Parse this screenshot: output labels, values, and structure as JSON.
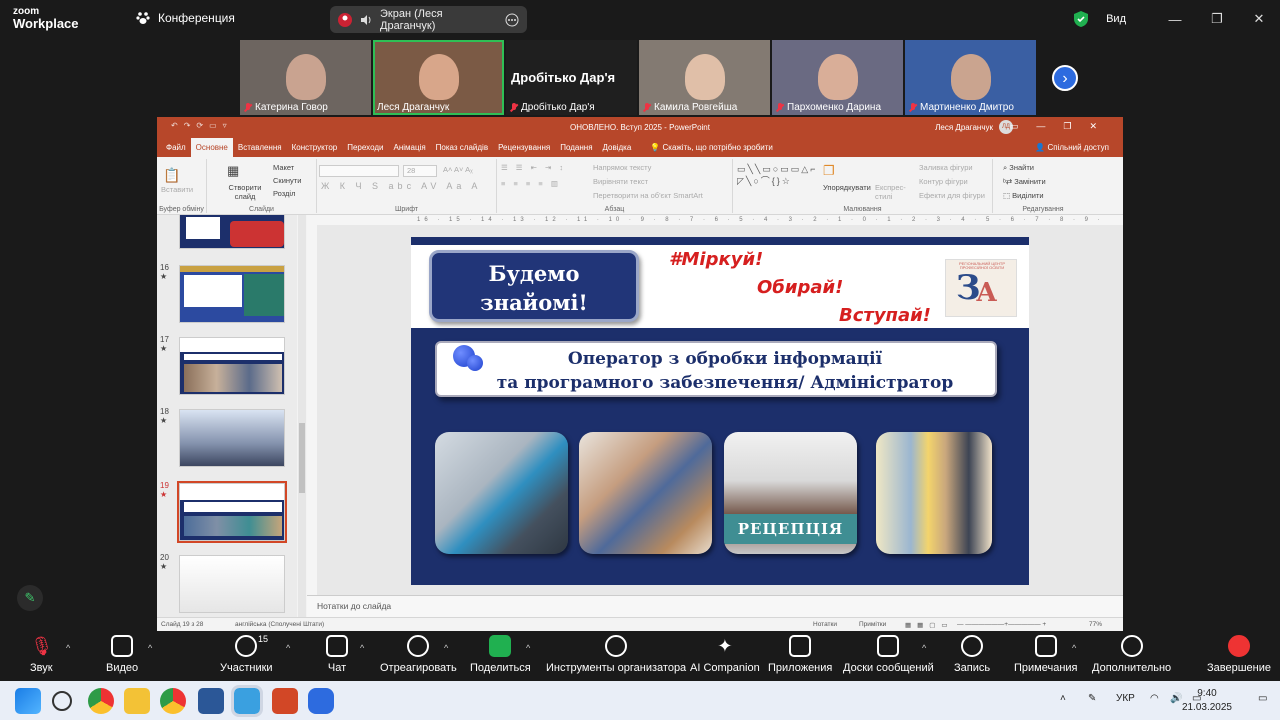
{
  "zoom": {
    "logo_line1": "zoom",
    "logo_line2": "Workplace",
    "conference_label": "Конференция",
    "share_label": "Экран (Леся Драганчук)",
    "view_label": "Вид",
    "more": "···"
  },
  "participants": [
    {
      "name": "Катерина Говор",
      "active": false
    },
    {
      "name": "Леся Драганчук",
      "active": true
    },
    {
      "name": "Дробітько Дар'я",
      "big_label": "Дробітько Дар'я",
      "active": false
    },
    {
      "name": "Камила Ровгейша",
      "active": false
    },
    {
      "name": "Пархоменко Дарина",
      "active": false
    },
    {
      "name": "Мартиненко Дмитро",
      "active": false
    }
  ],
  "ppt": {
    "title": "ОНОВЛЕНО. Вступ 2025  -  PowerPoint",
    "user": "Леся Драганчук",
    "avatar": "ЛД",
    "tabs": [
      "Файл",
      "Основне",
      "Вставлення",
      "Конструктор",
      "Переходи",
      "Анімація",
      "Показ слайдів",
      "Рецензування",
      "Подання",
      "Довідка"
    ],
    "tell_me": "Скажіть, що потрібно зробити",
    "share_access": "Спільний доступ",
    "ribbon": {
      "paste": "Вставити",
      "create_slide": "Створити слайд",
      "layout": "Макет",
      "reset": "Скинути",
      "section": "Розділ",
      "font_size": "28",
      "text_direction": "Напрямок тексту",
      "align_text": "Вирівняти текст",
      "smartart": "Перетворити на об'єкт SmartArt",
      "arrange": "Упорядкувати",
      "express_styles": "Експрес-стилі",
      "fill": "Заливка фігури",
      "outline": "Контур фігури",
      "effects": "Ефекти для фігури",
      "find": "Знайти",
      "replace": "Замінити",
      "select": "Виділити",
      "group_clipboard": "Буфер обміну",
      "group_slides": "Слайди",
      "group_font": "Шрифт",
      "group_paragraph": "Абзац",
      "group_drawing": "Малювання",
      "group_editing": "Редагування"
    },
    "ruler": "16 · 15 · 14 · 13 · 12 · 11 · 10 · 9 · 8 · 7 · 6 · 5 · 4 · 3 · 2 · 1 · 0 · 1 · 2 · 3 · 4 · 5 · 6 · 7 · 8 · 9 · 10 · 11 · 12 · 13 · 14 · 15 · 16",
    "thumb_numbers": [
      "16",
      "17",
      "18",
      "19",
      "20"
    ],
    "notes_placeholder": "Нотатки до слайда",
    "status": {
      "slide": "Слайд 19 з 28",
      "lang": "англійська (Сполучені Штати)",
      "notes": "Нотатки",
      "comments": "Примітки",
      "zoom": "77%"
    }
  },
  "slide": {
    "hello": "Будемо знайомі!",
    "tag1": "#Міркуй!",
    "tag2": "Обирай!",
    "tag3": "Вступай!",
    "logo_caption": "РЕГІОНАЛЬНИЙ ЦЕНТР ПРОФЕСІЙНОЇ ОСВІТИ",
    "logo_letter1": "З",
    "logo_letter2": "А",
    "banner_line1": "Оператор з обробки інформації",
    "banner_line2": "та програмного забезпечення/ Адміністратор",
    "reception": "РЕЦЕПЦІЯ"
  },
  "toolbar": {
    "audio": "Звук",
    "video": "Видео",
    "participants": "Участники",
    "participants_count": "15",
    "chat": "Чат",
    "react": "Отреагировать",
    "share": "Поделиться",
    "host_tools": "Инструменты организатора",
    "ai": "AI Companion",
    "apps": "Приложения",
    "whiteboards": "Доски сообщений",
    "record": "Запись",
    "notes": "Примечания",
    "more": "Дополнительно",
    "end": "Завершение"
  },
  "taskbar": {
    "lang": "УКР",
    "time": "9:40",
    "date": "21.03.2025"
  },
  "colors": {
    "ppt_red": "#b7472a",
    "slide_navy": "#1c2f6b",
    "zoom_green": "#20b050"
  }
}
